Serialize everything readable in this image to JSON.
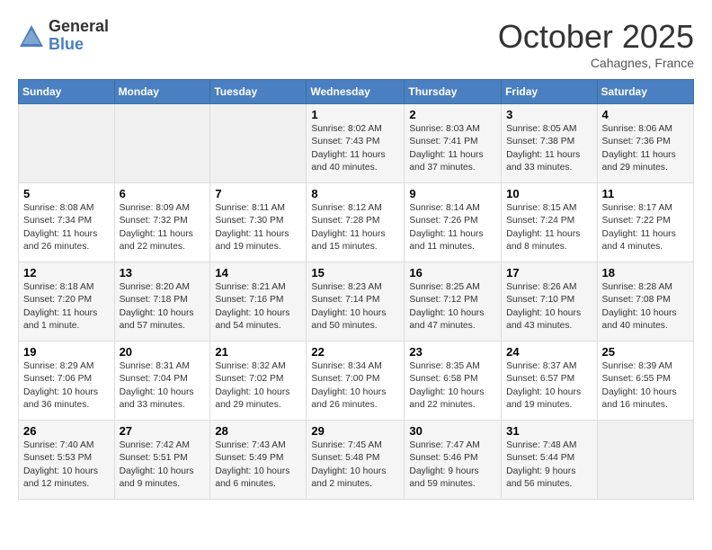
{
  "logo": {
    "general": "General",
    "blue": "Blue"
  },
  "title": "October 2025",
  "location": "Cahagnes, France",
  "weekdays": [
    "Sunday",
    "Monday",
    "Tuesday",
    "Wednesday",
    "Thursday",
    "Friday",
    "Saturday"
  ],
  "weeks": [
    [
      {
        "day": "",
        "info": ""
      },
      {
        "day": "",
        "info": ""
      },
      {
        "day": "",
        "info": ""
      },
      {
        "day": "1",
        "info": "Sunrise: 8:02 AM\nSunset: 7:43 PM\nDaylight: 11 hours\nand 40 minutes."
      },
      {
        "day": "2",
        "info": "Sunrise: 8:03 AM\nSunset: 7:41 PM\nDaylight: 11 hours\nand 37 minutes."
      },
      {
        "day": "3",
        "info": "Sunrise: 8:05 AM\nSunset: 7:38 PM\nDaylight: 11 hours\nand 33 minutes."
      },
      {
        "day": "4",
        "info": "Sunrise: 8:06 AM\nSunset: 7:36 PM\nDaylight: 11 hours\nand 29 minutes."
      }
    ],
    [
      {
        "day": "5",
        "info": "Sunrise: 8:08 AM\nSunset: 7:34 PM\nDaylight: 11 hours\nand 26 minutes."
      },
      {
        "day": "6",
        "info": "Sunrise: 8:09 AM\nSunset: 7:32 PM\nDaylight: 11 hours\nand 22 minutes."
      },
      {
        "day": "7",
        "info": "Sunrise: 8:11 AM\nSunset: 7:30 PM\nDaylight: 11 hours\nand 19 minutes."
      },
      {
        "day": "8",
        "info": "Sunrise: 8:12 AM\nSunset: 7:28 PM\nDaylight: 11 hours\nand 15 minutes."
      },
      {
        "day": "9",
        "info": "Sunrise: 8:14 AM\nSunset: 7:26 PM\nDaylight: 11 hours\nand 11 minutes."
      },
      {
        "day": "10",
        "info": "Sunrise: 8:15 AM\nSunset: 7:24 PM\nDaylight: 11 hours\nand 8 minutes."
      },
      {
        "day": "11",
        "info": "Sunrise: 8:17 AM\nSunset: 7:22 PM\nDaylight: 11 hours\nand 4 minutes."
      }
    ],
    [
      {
        "day": "12",
        "info": "Sunrise: 8:18 AM\nSunset: 7:20 PM\nDaylight: 11 hours\nand 1 minute."
      },
      {
        "day": "13",
        "info": "Sunrise: 8:20 AM\nSunset: 7:18 PM\nDaylight: 10 hours\nand 57 minutes."
      },
      {
        "day": "14",
        "info": "Sunrise: 8:21 AM\nSunset: 7:16 PM\nDaylight: 10 hours\nand 54 minutes."
      },
      {
        "day": "15",
        "info": "Sunrise: 8:23 AM\nSunset: 7:14 PM\nDaylight: 10 hours\nand 50 minutes."
      },
      {
        "day": "16",
        "info": "Sunrise: 8:25 AM\nSunset: 7:12 PM\nDaylight: 10 hours\nand 47 minutes."
      },
      {
        "day": "17",
        "info": "Sunrise: 8:26 AM\nSunset: 7:10 PM\nDaylight: 10 hours\nand 43 minutes."
      },
      {
        "day": "18",
        "info": "Sunrise: 8:28 AM\nSunset: 7:08 PM\nDaylight: 10 hours\nand 40 minutes."
      }
    ],
    [
      {
        "day": "19",
        "info": "Sunrise: 8:29 AM\nSunset: 7:06 PM\nDaylight: 10 hours\nand 36 minutes."
      },
      {
        "day": "20",
        "info": "Sunrise: 8:31 AM\nSunset: 7:04 PM\nDaylight: 10 hours\nand 33 minutes."
      },
      {
        "day": "21",
        "info": "Sunrise: 8:32 AM\nSunset: 7:02 PM\nDaylight: 10 hours\nand 29 minutes."
      },
      {
        "day": "22",
        "info": "Sunrise: 8:34 AM\nSunset: 7:00 PM\nDaylight: 10 hours\nand 26 minutes."
      },
      {
        "day": "23",
        "info": "Sunrise: 8:35 AM\nSunset: 6:58 PM\nDaylight: 10 hours\nand 22 minutes."
      },
      {
        "day": "24",
        "info": "Sunrise: 8:37 AM\nSunset: 6:57 PM\nDaylight: 10 hours\nand 19 minutes."
      },
      {
        "day": "25",
        "info": "Sunrise: 8:39 AM\nSunset: 6:55 PM\nDaylight: 10 hours\nand 16 minutes."
      }
    ],
    [
      {
        "day": "26",
        "info": "Sunrise: 7:40 AM\nSunset: 5:53 PM\nDaylight: 10 hours\nand 12 minutes."
      },
      {
        "day": "27",
        "info": "Sunrise: 7:42 AM\nSunset: 5:51 PM\nDaylight: 10 hours\nand 9 minutes."
      },
      {
        "day": "28",
        "info": "Sunrise: 7:43 AM\nSunset: 5:49 PM\nDaylight: 10 hours\nand 6 minutes."
      },
      {
        "day": "29",
        "info": "Sunrise: 7:45 AM\nSunset: 5:48 PM\nDaylight: 10 hours\nand 2 minutes."
      },
      {
        "day": "30",
        "info": "Sunrise: 7:47 AM\nSunset: 5:46 PM\nDaylight: 9 hours\nand 59 minutes."
      },
      {
        "day": "31",
        "info": "Sunrise: 7:48 AM\nSunset: 5:44 PM\nDaylight: 9 hours\nand 56 minutes."
      },
      {
        "day": "",
        "info": ""
      }
    ]
  ]
}
